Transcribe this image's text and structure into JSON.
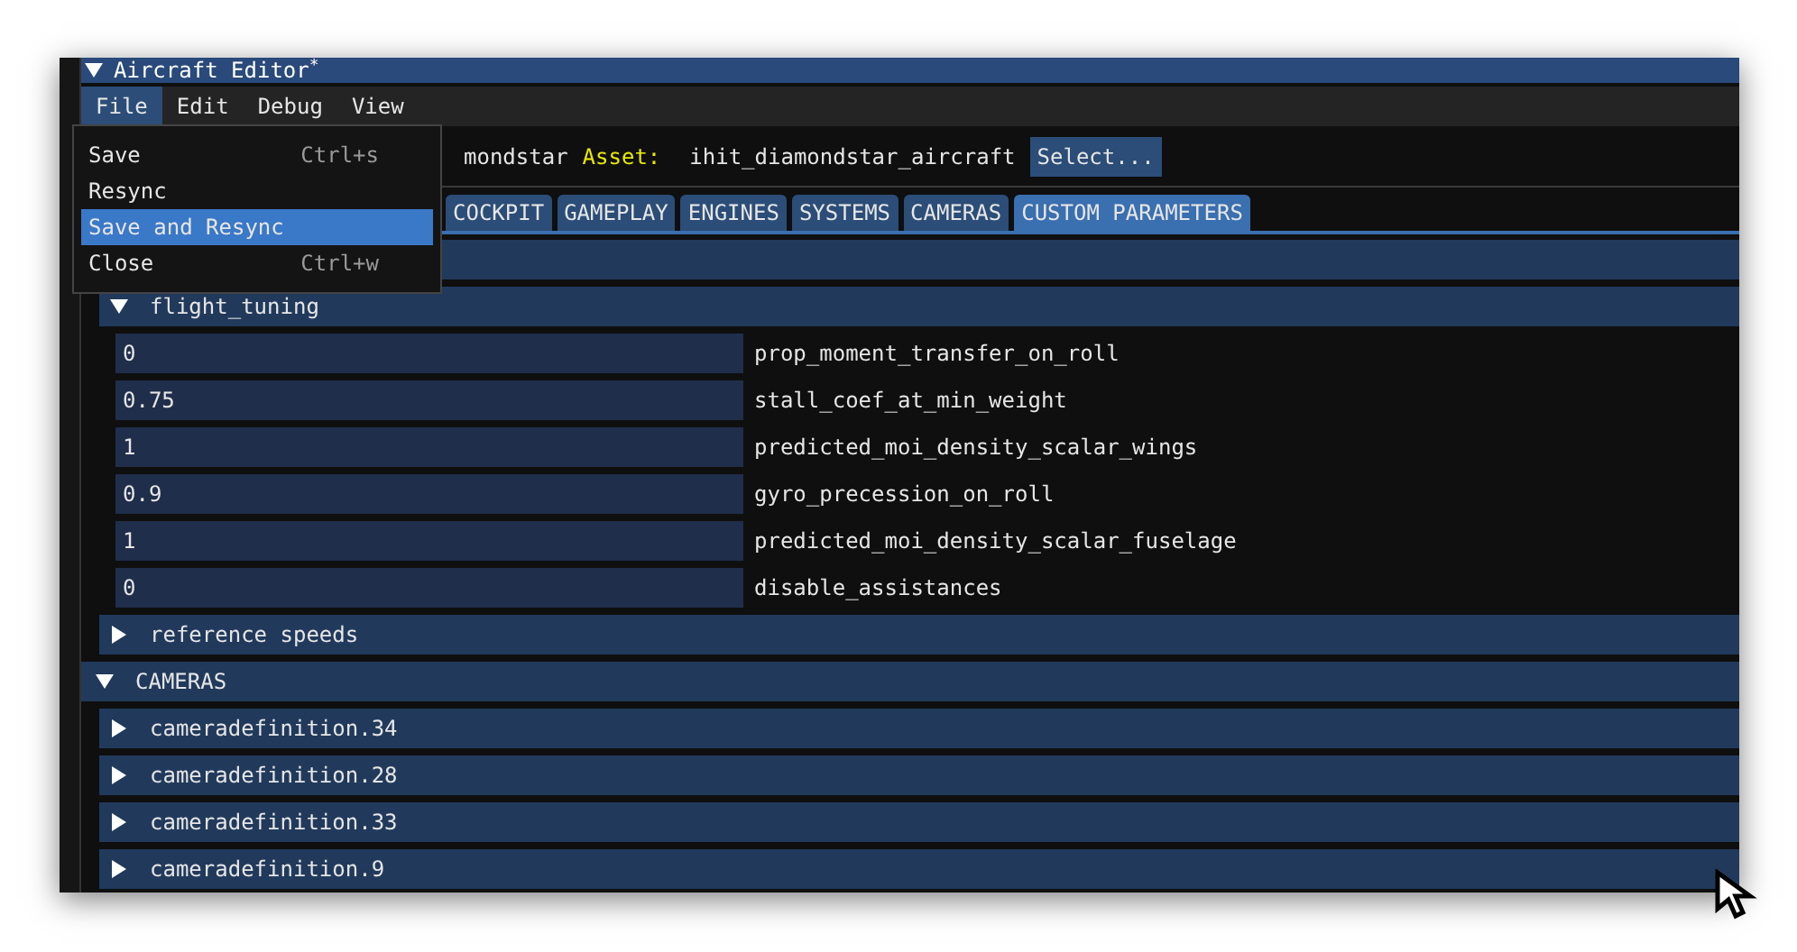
{
  "window": {
    "title": "Aircraft Editor",
    "modified_mark": "*"
  },
  "menu_bar": [
    {
      "label": "File",
      "selected": true
    },
    {
      "label": "Edit",
      "selected": false
    },
    {
      "label": "Debug",
      "selected": false
    },
    {
      "label": "View",
      "selected": false
    }
  ],
  "file_menu": [
    {
      "label": "Save",
      "shortcut": "Ctrl+s",
      "selected": false
    },
    {
      "label": "Resync",
      "selected": false
    },
    {
      "label": "Save and Resync",
      "selected": true
    },
    {
      "label": "Close",
      "shortcut": "Ctrl+w",
      "selected": false
    }
  ],
  "asset_row": {
    "package_value_visible": "mondstar",
    "asset_label": "Asset:",
    "asset_value": "ihit_diamondstar_aircraft",
    "select_button": "Select..."
  },
  "tabs": [
    {
      "label": "COCKPIT",
      "selected": false
    },
    {
      "label": "GAMEPLAY",
      "selected": false
    },
    {
      "label": "ENGINES",
      "selected": false
    },
    {
      "label": "SYSTEMS",
      "selected": false
    },
    {
      "label": "CAMERAS",
      "selected": false
    },
    {
      "label": "CUSTOM PARAMETERS",
      "selected": true
    }
  ],
  "sections": [
    {
      "expanded": true,
      "groups": [
        {
          "title": "flight_tuning",
          "expanded": true,
          "fields": [
            {
              "value": "0",
              "name": "prop_moment_transfer_on_roll"
            },
            {
              "value": "0.75",
              "name": "stall_coef_at_min_weight"
            },
            {
              "value": "1",
              "name": "predicted_moi_density_scalar_wings"
            },
            {
              "value": "0.9",
              "name": "gyro_precession_on_roll"
            },
            {
              "value": "1",
              "name": "predicted_moi_density_scalar_fuselage"
            },
            {
              "value": "0",
              "name": "disable_assistances"
            }
          ]
        },
        {
          "title": "reference speeds",
          "expanded": false
        }
      ]
    },
    {
      "title": "CAMERAS",
      "expanded": true,
      "groups": [
        {
          "title": "cameradefinition.34",
          "expanded": false
        },
        {
          "title": "cameradefinition.28",
          "expanded": false
        },
        {
          "title": "cameradefinition.33",
          "expanded": false
        },
        {
          "title": "cameradefinition.9",
          "expanded": false
        }
      ]
    }
  ]
}
